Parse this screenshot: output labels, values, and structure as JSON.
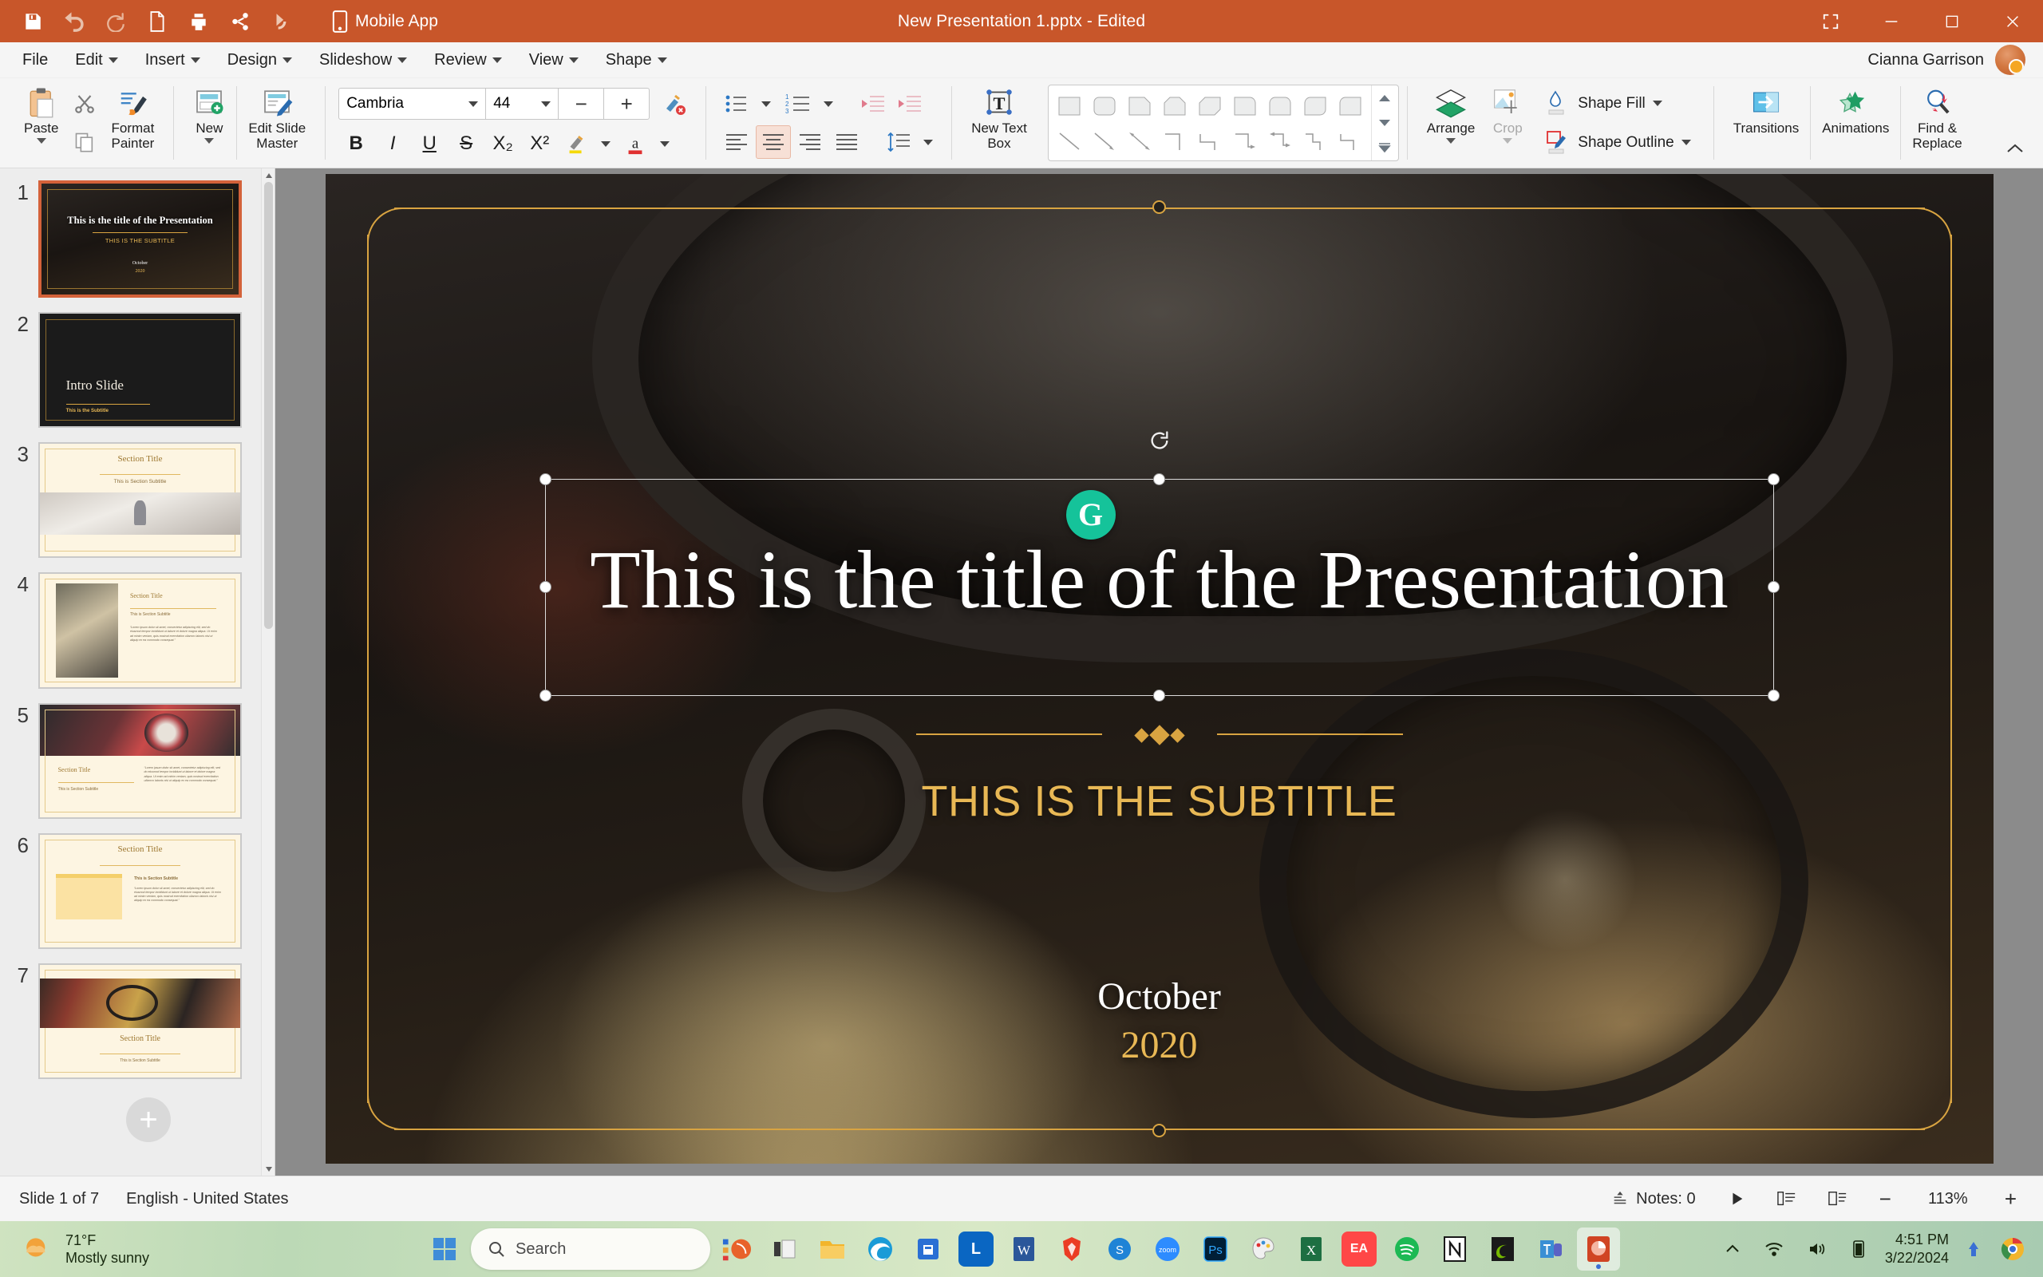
{
  "titlebar": {
    "document_title": "New Presentation 1.pptx - Edited",
    "mobile_app_label": "Mobile App",
    "quick_access": [
      {
        "name": "save-icon",
        "tooltip": "Save"
      },
      {
        "name": "undo-icon",
        "tooltip": "Undo"
      },
      {
        "name": "redo-icon",
        "tooltip": "Redo"
      },
      {
        "name": "new-document-icon",
        "tooltip": "New"
      },
      {
        "name": "print-icon",
        "tooltip": "Print"
      },
      {
        "name": "share-icon",
        "tooltip": "Share"
      },
      {
        "name": "present-icon",
        "tooltip": "Present"
      }
    ],
    "window_controls": [
      "fullscreen-icon",
      "minimize-icon",
      "maximize-icon",
      "close-icon"
    ],
    "accent_color": "#c8562a"
  },
  "menubar": {
    "items": [
      {
        "label": "File",
        "has_caret": false
      },
      {
        "label": "Edit",
        "has_caret": true
      },
      {
        "label": "Insert",
        "has_caret": true
      },
      {
        "label": "Design",
        "has_caret": true
      },
      {
        "label": "Slideshow",
        "has_caret": true
      },
      {
        "label": "Review",
        "has_caret": true
      },
      {
        "label": "View",
        "has_caret": true
      },
      {
        "label": "Shape",
        "has_caret": true
      }
    ],
    "account_name": "Cianna Garrison"
  },
  "ribbon": {
    "clipboard": {
      "paste_label": "Paste",
      "cut_icon": "scissors-icon",
      "copy_icon": "copy-icon",
      "format_painter_label": "Format\nPainter"
    },
    "slides": {
      "new_label": "New",
      "edit_slide_master_label": "Edit Slide\nMaster"
    },
    "font": {
      "family": "Cambria",
      "size": "44",
      "decrease_label": "−",
      "increase_label": "+",
      "clear_formatting_icon": "clear-formatting-icon",
      "bold": "B",
      "italic": "I",
      "underline": "U",
      "strikethrough": "S",
      "subscript": "X₂",
      "superscript": "X²",
      "highlight_icon": "text-highlight-icon",
      "font_color_icon": "font-color-icon"
    },
    "paragraph": {
      "bullets_icon": "bulleted-list-icon",
      "numbering_icon": "numbered-list-icon",
      "decrease_indent_icon": "decrease-indent-icon",
      "increase_indent_icon": "increase-indent-icon",
      "align_left_icon": "align-left-icon",
      "align_center_icon": "align-center-icon",
      "align_right_icon": "align-right-icon",
      "justify_icon": "align-justify-icon",
      "line_spacing_icon": "line-spacing-icon",
      "active_alignment": "center"
    },
    "textbox": {
      "new_text_box_label": "New Text\nBox"
    },
    "arrange": {
      "arrange_label": "Arrange",
      "crop_label": "Crop",
      "crop_disabled": true,
      "shape_fill_label": "Shape Fill",
      "shape_outline_label": "Shape Outline"
    },
    "right_tools": [
      {
        "label": "Transitions",
        "icon": "transitions-icon"
      },
      {
        "label": "Animations",
        "icon": "animations-star-icon"
      },
      {
        "label": "Find &\nReplace",
        "icon": "find-replace-icon"
      }
    ],
    "collapse_icon": "chevron-up-icon"
  },
  "thumbnails": {
    "selected_index": 1,
    "add_slide_label": "+",
    "slides": [
      {
        "number": "1",
        "type": "title-photo",
        "title": "This is the title of the Presentation",
        "subtitle": "THIS IS THE SUBTITLE",
        "month": "October",
        "year": "2020"
      },
      {
        "number": "2",
        "type": "dark-intro",
        "title": "Intro Slide",
        "subtitle": "This is the Subtitle"
      },
      {
        "number": "3",
        "type": "section-photo-below",
        "title": "Section Title",
        "subtitle": "This is Section Subtitle"
      },
      {
        "number": "4",
        "type": "photo-left-text-right",
        "title": "Section Title",
        "subtitle": "This is Section Subtitle",
        "body": "“Lorem ipsum dolor sit amet, consectetur adipiscing elit, sed do eiusmod tempor incididunt ut labore et dolore magna aliqua. Ut enim ad minim veniam, quis nostrud exercitation ullamco laboris nisi ut aliquip ex ea commodo consequat.”"
      },
      {
        "number": "5",
        "type": "photo-top-text-bottom",
        "title": "Section Title",
        "subtitle": "This is Section Subtitle",
        "body": "“Lorem ipsum dolor sit amet, consectetur adipiscing elit, sed do eiusmod tempor incididunt ut labore et dolore magna aliqua. Ut enim ad minim veniam, quis nostrud exercitation ullamco laboris nisi ut aliquip ex ea commodo consequat.”"
      },
      {
        "number": "6",
        "type": "block-left-text-right",
        "title": "Section Title",
        "subtitle": "This is Section Subtitle",
        "body": "“Lorem ipsum dolor sit amet, consectetur adipiscing elit, sed do eiusmod tempor incididunt ut labore et dolore magna aliqua. Ut enim ad minim veniam, quis nostrud exercitation ullamco laboris nisi ut aliquip ex ea commodo consequat.”"
      },
      {
        "number": "7",
        "type": "photo-band-title-below",
        "title": "Section Title",
        "subtitle": "This is Section Subtitle"
      }
    ]
  },
  "slide": {
    "title": "This is the title of the Presentation",
    "subtitle": "THIS IS THE SUBTITLE",
    "date_month": "October",
    "date_year": "2020",
    "grammarly_badge": "G",
    "gold_color": "#d9a441",
    "subtitle_color": "#e8b855"
  },
  "statusbar": {
    "slide_counter": "Slide 1 of 7",
    "language": "English - United States",
    "notes_label": "Notes: 0",
    "play_icon": "play-icon",
    "normal_view_icon": "normal-view-icon",
    "outline_view_icon": "outline-view-icon",
    "zoom_out": "−",
    "zoom_level": "113%",
    "zoom_in": "+"
  },
  "taskbar": {
    "weather_temp": "71°F",
    "weather_desc": "Mostly sunny",
    "search_placeholder": "Search",
    "time": "4:51 PM",
    "date": "3/22/2024",
    "apps": [
      {
        "name": "start-icon",
        "label": "",
        "color": "#2e7fd4"
      },
      {
        "name": "copilot-icon",
        "label": "",
        "color": "#e06020"
      },
      {
        "name": "task-view-icon",
        "label": "",
        "color": "#3a3a3a"
      },
      {
        "name": "file-explorer-icon",
        "label": "",
        "color": "#f2b52c"
      },
      {
        "name": "edge-icon",
        "label": "",
        "color": "#1e8fd0"
      },
      {
        "name": "store-icon",
        "label": "",
        "color": "#2a6fd4"
      },
      {
        "name": "linkedin-icon",
        "label": "L",
        "color": "#0a66c2"
      },
      {
        "name": "word-icon",
        "label": "",
        "color": "#2b579a"
      },
      {
        "name": "brave-icon",
        "label": "",
        "color": "#eb3c24"
      },
      {
        "name": "skype-icon",
        "label": "",
        "color": "#1f83d6"
      },
      {
        "name": "zoom-icon",
        "label": "zoom",
        "color": "#2d8cff"
      },
      {
        "name": "photoshop-icon",
        "label": "Ps",
        "color": "#001e36"
      },
      {
        "name": "paint-icon",
        "label": "",
        "color": "#cc4b4c"
      },
      {
        "name": "excel-icon",
        "label": "",
        "color": "#1d6f42"
      },
      {
        "name": "ea-icon",
        "label": "EA",
        "color": "#ff4747"
      },
      {
        "name": "spotify-icon",
        "label": "",
        "color": "#1db954"
      },
      {
        "name": "notion-icon",
        "label": "N",
        "color": "#1a1a1a"
      },
      {
        "name": "nvidia-icon",
        "label": "",
        "color": "#76b900"
      },
      {
        "name": "teams-icon",
        "label": "",
        "color": "#4b53bc"
      },
      {
        "name": "powerpoint-icon",
        "label": "",
        "color": "#d04423"
      }
    ],
    "tray": [
      "show-hidden-icons-icon",
      "wifi-icon",
      "volume-icon",
      "battery-icon"
    ],
    "notification_icons": [
      "onedrive-icon",
      "chrome-icon"
    ]
  }
}
